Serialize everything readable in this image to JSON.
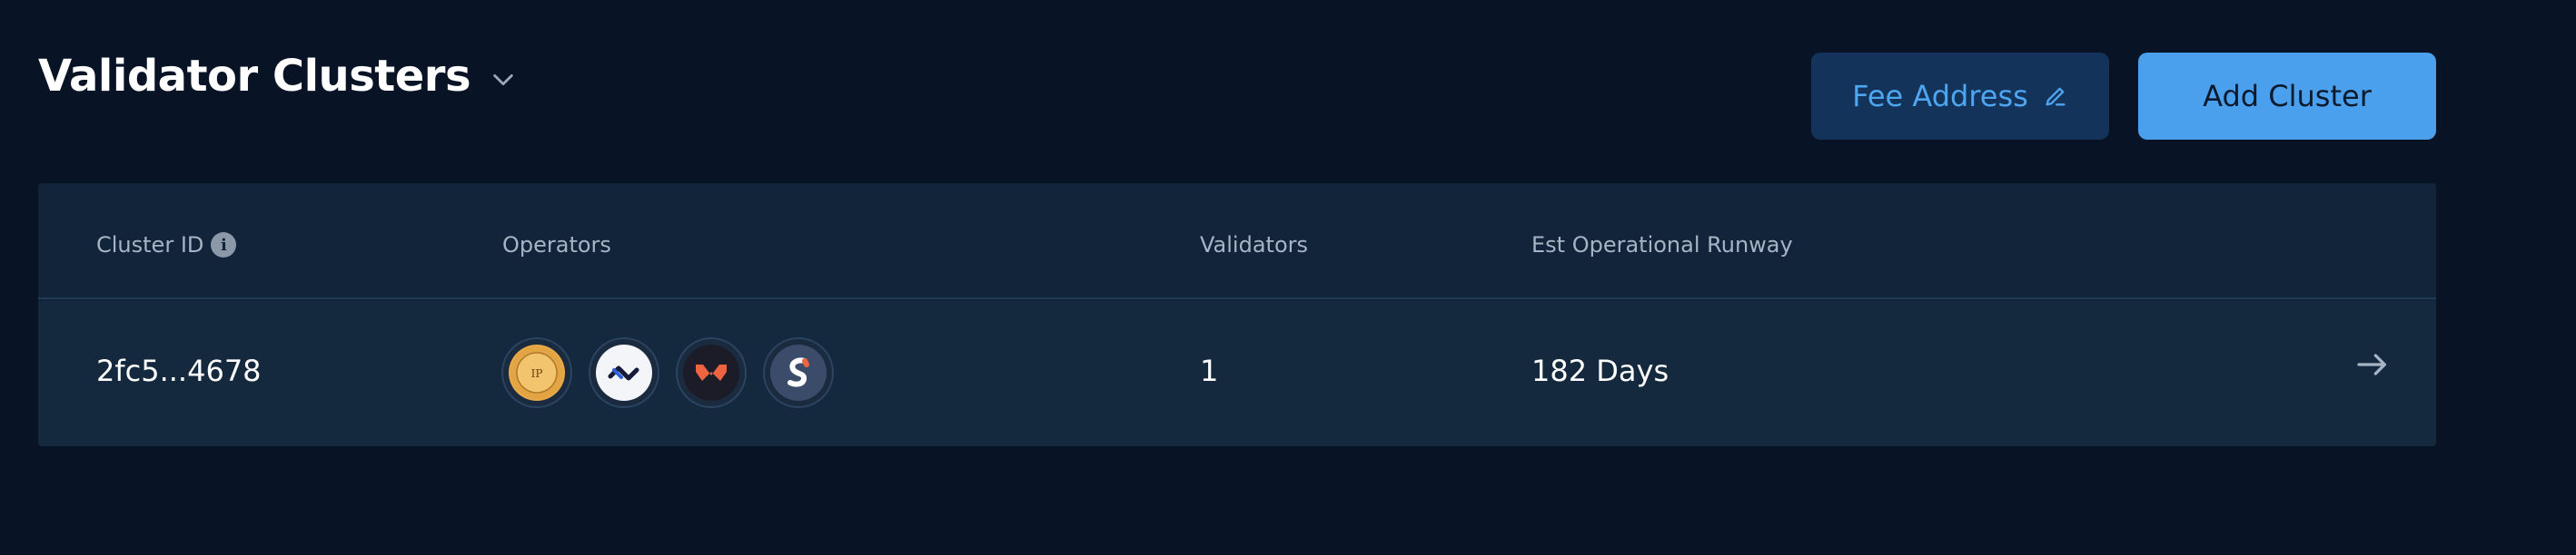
{
  "header": {
    "title": "Validator Clusters",
    "chevron_icon": "chevron-down-icon"
  },
  "actions": {
    "fee_address_label": "Fee Address",
    "fee_address_icon": "pencil-icon",
    "add_cluster_label": "Add Cluster"
  },
  "table": {
    "columns": {
      "cluster_id": "Cluster ID",
      "cluster_id_info_icon": "info-icon",
      "operators": "Operators",
      "validators": "Validators",
      "runway": "Est Operational Runway"
    },
    "rows": [
      {
        "cluster_id": "2fc5...4678",
        "operators": [
          "operator-ip-logo",
          "operator-chain-link-logo",
          "operator-orange-mark-logo",
          "operator-s-logo"
        ],
        "operator_1_logo_text": "IP",
        "validators": "1",
        "runway": "182 Days",
        "row_action_icon": "arrow-right-icon"
      }
    ]
  },
  "colors": {
    "background": "#081425",
    "table_bg": "#11243a",
    "row_bg": "#15293e",
    "accent": "#4ba0ee",
    "fee_button_bg": "#13335a",
    "fee_button_text": "#4ea6f0"
  }
}
